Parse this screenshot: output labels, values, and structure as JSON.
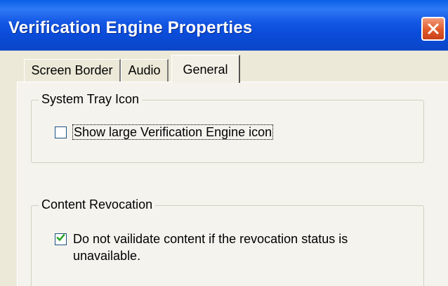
{
  "window": {
    "title": "Verification Engine Properties",
    "close_icon": "close-icon"
  },
  "tabs": [
    {
      "label": "Screen Border",
      "selected": false
    },
    {
      "label": "Audio",
      "selected": false
    },
    {
      "label": "General",
      "selected": true
    }
  ],
  "groups": {
    "system_tray": {
      "legend": "System Tray Icon",
      "checkbox_label": "Show large Verification Engine icon",
      "checked": false
    },
    "content_revocation": {
      "legend": "Content Revocation",
      "checkbox_label_line1": "Do not vailidate content if the revocation status is",
      "checkbox_label_line2": "unavailable.",
      "checked": true
    }
  },
  "colors": {
    "titlebar": "#0a4bd8",
    "close_button": "#e05a2a",
    "face": "#ece9d8",
    "tab_page": "#f4f3ee",
    "group_border": "#d0d0bf"
  }
}
